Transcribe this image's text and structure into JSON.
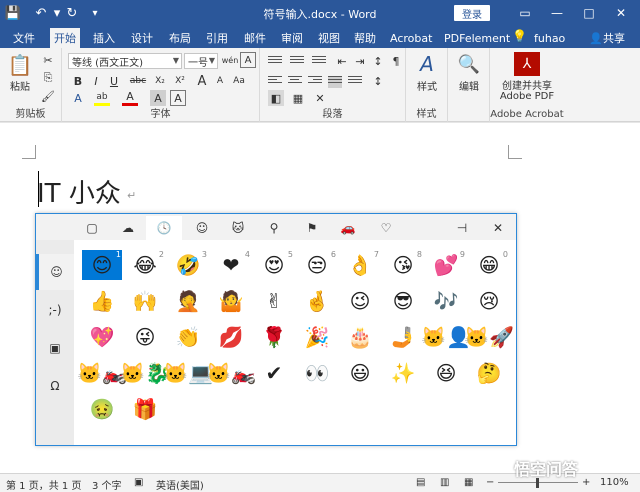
{
  "window": {
    "title": "符号输入.docx - Word",
    "login_label": "登录",
    "quick_access": {
      "save_icon": "💾",
      "undo_icon": "↶",
      "redo_icon": "↻",
      "more_icon": "▾"
    },
    "controls": {
      "ribbon_options": "▭",
      "minimize": "—",
      "maximize": "□",
      "close": "✕"
    }
  },
  "tabs": [
    {
      "label": "文件"
    },
    {
      "label": "开始"
    },
    {
      "label": "插入"
    },
    {
      "label": "设计"
    },
    {
      "label": "布局"
    },
    {
      "label": "引用"
    },
    {
      "label": "邮件"
    },
    {
      "label": "审阅"
    },
    {
      "label": "视图"
    },
    {
      "label": "帮助"
    },
    {
      "label": "Acrobat"
    },
    {
      "label": "PDFelement"
    }
  ],
  "tabs_extra": {
    "tell_me_icon": "💡",
    "user": "fuhao",
    "share_label": "共享",
    "share_icon": "👤"
  },
  "ribbon": {
    "clipboard": {
      "label": "剪贴板",
      "paste_label": "粘贴",
      "paste_icon": "📋",
      "cut_icon": "✂",
      "copy_icon": "⎘",
      "painter_icon": "🖌"
    },
    "font": {
      "label": "字体",
      "font_name": "等线 (西文正文)",
      "font_size": "一号",
      "wen_icon": "wén",
      "a_icon": "A",
      "bold": "B",
      "italic": "I",
      "underline": "U",
      "strike": "abc",
      "sub": "X₂",
      "sup": "X²",
      "grow_icon": "A",
      "shrink_icon": "A",
      "case_icon": "Aa",
      "clear_icon": "A",
      "highlight_icon": "ab",
      "color_icon": "A",
      "shade_icon": "A",
      "border_icon": "A"
    },
    "paragraph": {
      "label": "段落",
      "sort_icon": "↕",
      "marks_icon": "¶",
      "indent_dec_icon": "⇤",
      "indent_inc_icon": "⇥",
      "chinese_layout_icon": "✕"
    },
    "styles": {
      "label": "样式",
      "button_label": "样式",
      "icon": "A"
    },
    "editing": {
      "label": "编辑",
      "icon": "🔍"
    },
    "acrobat": {
      "label": "Adobe Acrobat",
      "button_label_1": "创建并共享",
      "button_label_2": "Adobe PDF"
    }
  },
  "document": {
    "text": "IT 小众",
    "paragraph_mark": "↵"
  },
  "emoji_panel": {
    "categories": [
      {
        "name": "recent",
        "icon": "▢"
      },
      {
        "name": "weather",
        "icon": "☁"
      },
      {
        "name": "time",
        "icon": "🕓"
      },
      {
        "name": "smiley",
        "icon": "☺"
      },
      {
        "name": "animal",
        "icon": "🐱"
      },
      {
        "name": "food",
        "icon": "⚲"
      },
      {
        "name": "flag",
        "icon": "⚑"
      },
      {
        "name": "car",
        "icon": "🚗"
      },
      {
        "name": "heart",
        "icon": "♡"
      }
    ],
    "pin_icon": "⊣",
    "close_icon": "✕",
    "sidebar": [
      {
        "name": "emoji",
        "label": "☺"
      },
      {
        "name": "kaomoji",
        "label": ";-)"
      },
      {
        "name": "gif",
        "label": "▣"
      },
      {
        "name": "symbols",
        "label": "Ω"
      }
    ],
    "emoji_rows": [
      [
        {
          "e": "😊",
          "n": "1"
        },
        {
          "e": "😂",
          "n": "2"
        },
        {
          "e": "🤣",
          "n": "3"
        },
        {
          "e": "❤",
          "n": "4"
        },
        {
          "e": "😍",
          "n": "5"
        },
        {
          "e": "😒",
          "n": "6"
        },
        {
          "e": "👌",
          "n": "7"
        },
        {
          "e": "😘",
          "n": "8"
        },
        {
          "e": "💕",
          "n": "9"
        },
        {
          "e": "😁",
          "n": "0"
        }
      ],
      [
        {
          "e": "👍",
          "n": ""
        },
        {
          "e": "🙌",
          "n": ""
        },
        {
          "e": "🤦",
          "n": ""
        },
        {
          "e": "🤷",
          "n": ""
        },
        {
          "e": "✌",
          "n": ""
        },
        {
          "e": "🤞",
          "n": ""
        },
        {
          "e": "😉",
          "n": ""
        },
        {
          "e": "😎",
          "n": ""
        },
        {
          "e": "🎶",
          "n": ""
        },
        {
          "e": "😢",
          "n": ""
        }
      ],
      [
        {
          "e": "💖",
          "n": ""
        },
        {
          "e": "😜",
          "n": ""
        },
        {
          "e": "👏",
          "n": ""
        },
        {
          "e": "💋",
          "n": ""
        },
        {
          "e": "🌹",
          "n": ""
        },
        {
          "e": "🎉",
          "n": ""
        },
        {
          "e": "🎂",
          "n": ""
        },
        {
          "e": "🤳",
          "n": ""
        },
        {
          "e": "🐱‍👤",
          "n": ""
        },
        {
          "e": "🐱‍🚀",
          "n": ""
        }
      ],
      [
        {
          "e": "🐱‍🏍",
          "n": ""
        },
        {
          "e": "🐱‍🐉",
          "n": ""
        },
        {
          "e": "🐱‍💻",
          "n": ""
        },
        {
          "e": "🐱‍🏍",
          "n": ""
        },
        {
          "e": "✔",
          "n": ""
        },
        {
          "e": "👀",
          "n": ""
        },
        {
          "e": "😃",
          "n": ""
        },
        {
          "e": "✨",
          "n": ""
        },
        {
          "e": "😆",
          "n": ""
        },
        {
          "e": "🤔",
          "n": ""
        }
      ],
      [
        {
          "e": "🤢",
          "n": ""
        },
        {
          "e": "🎁",
          "n": ""
        }
      ]
    ]
  },
  "status": {
    "page": "第 1 页，共 1 页",
    "words": "3 个字",
    "macro_icon": "▣",
    "language": "英语(美国)",
    "zoom": "110%"
  },
  "watermark": "悟空问答"
}
